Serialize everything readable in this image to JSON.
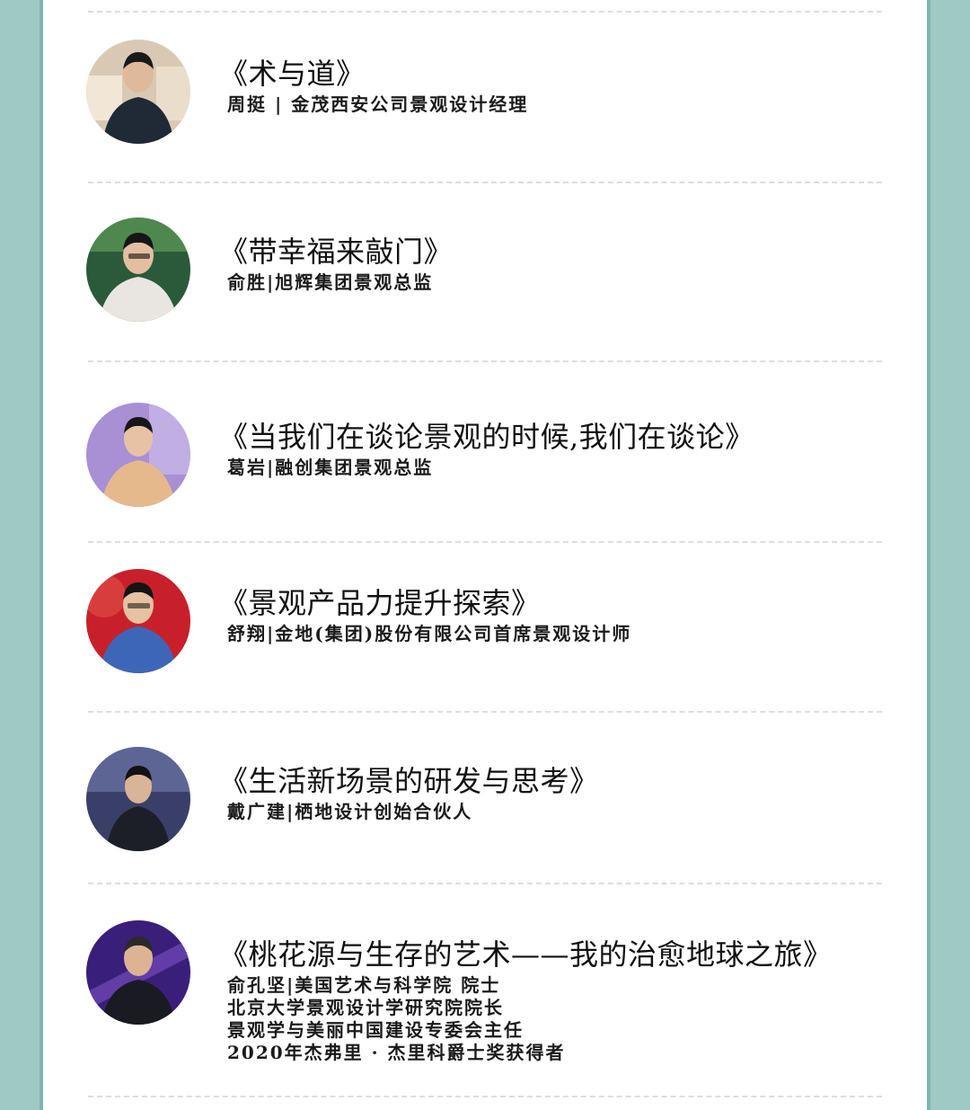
{
  "speakers": [
    {
      "title": "《术与道》",
      "info": [
        "周挺 | 金茂西安公司景观设计经理"
      ],
      "avatar": {
        "bg": "#d9c9b4",
        "accent": "#f2e6d6",
        "shirt": "#1f2a36",
        "skin": "#e0b89a",
        "hair": "#1a1a1a"
      }
    },
    {
      "title": "《带幸福来敲门》",
      "info": [
        "俞胜|旭辉集团景观总监"
      ],
      "avatar": {
        "bg": "#2b5a3a",
        "accent": "#7cc26a",
        "shirt": "#e9e6e1",
        "skin": "#e3bea0",
        "hair": "#161616"
      }
    },
    {
      "title": "《当我们在谈论景观的时候,我们在谈论》",
      "info": [
        "葛岩|融创集团景观总监"
      ],
      "avatar": {
        "bg": "#a98fd4",
        "accent": "#d9cdf0",
        "shirt": "#e5b98c",
        "skin": "#e7c2a4",
        "hair": "#171717"
      }
    },
    {
      "title": "《景观产品力提升探索》",
      "info": [
        "舒翔|金地(集团)股份有限公司首席景观设计师"
      ],
      "avatar": {
        "bg": "#c8202a",
        "accent": "#e85a50",
        "shirt": "#3d66b8",
        "skin": "#e6c1a2",
        "hair": "#141414"
      }
    },
    {
      "title": "《生活新场景的研发与思考》",
      "info": [
        "戴广建|栖地设计创始合伙人"
      ],
      "avatar": {
        "bg": "#3a3f6a",
        "accent": "#7f8bc0",
        "shirt": "#1d1f28",
        "skin": "#d9b497",
        "hair": "#121212"
      }
    },
    {
      "title": "《桃花源与生存的艺术——我的治愈地球之旅》",
      "info": [
        "俞孔坚|美国艺术与科学院 院士",
        "北京大学景观设计学研究院院长",
        "景观学与美丽中国建设专委会主任",
        "2020年杰弗里 · 杰里科爵士奖获得者"
      ],
      "avatar": {
        "bg": "#3a1f7a",
        "accent": "#8a5cd6",
        "shirt": "#1a1a22",
        "skin": "#dcb493",
        "hair": "#2a2a2a"
      }
    }
  ]
}
